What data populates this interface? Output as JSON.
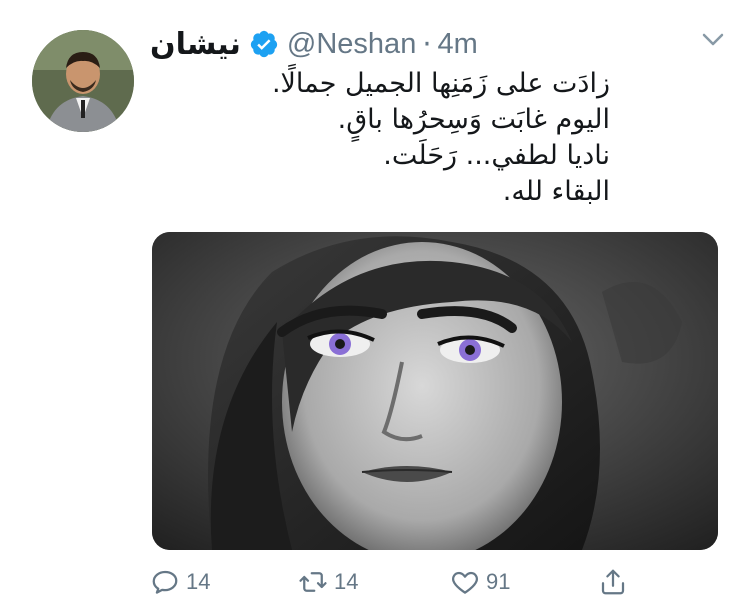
{
  "tweet": {
    "author": {
      "display_name": "نيشان",
      "handle": "@Neshan",
      "separator": "·",
      "time": "4m",
      "verified": true
    },
    "text_lines": [
      "زادَت على زَمَنِها الجميل جمالًا.",
      "اليوم غابَت وَسِحرُها باقٍ.",
      "ناديا لطفي... رَحَلَت.",
      "البقاء لله."
    ],
    "media": {
      "kind": "photo",
      "description": "black and white portrait of a woman with violet eyes"
    },
    "actions": {
      "reply_count": "14",
      "retweet_count": "14",
      "like_count": "91"
    },
    "colors": {
      "verified_blue": "#1da1f2",
      "secondary_text": "#657786",
      "primary_text": "#14171a",
      "eye_tint": "#8a6fd6"
    }
  }
}
